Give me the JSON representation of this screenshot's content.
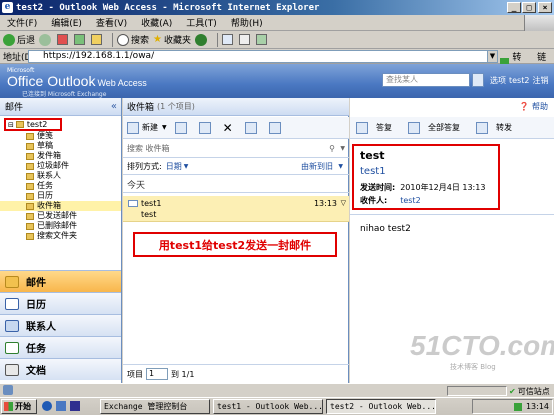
{
  "window": {
    "title": "test2 - Outlook Web Access - Microsoft Internet Explorer"
  },
  "menubar": [
    "文件(F)",
    "编辑(E)",
    "查看(V)",
    "收藏(A)",
    "工具(T)",
    "帮助(H)"
  ],
  "toolbar": {
    "back": "后退",
    "search": "搜索",
    "favorites": "收藏夹"
  },
  "address": {
    "label": "地址(D)",
    "url": "https://192.168.1.1/owa/",
    "go": "转到",
    "links": "链接"
  },
  "owa": {
    "ms_label": "Microsoft",
    "product": "Office Outlook",
    "product_suffix": "Web Access",
    "subtitle": "已连接到 Microsoft Exchange",
    "find_placeholder": "查找某人",
    "options": "选项",
    "user": "test2",
    "logout": "注销"
  },
  "left_nav": {
    "header": "邮件",
    "root": "test2",
    "folders": [
      "便笺",
      "草稿",
      "发件箱",
      "垃圾邮件",
      "联系人",
      "任务",
      "日历",
      "收件箱",
      "已发送邮件",
      "已删除邮件",
      "搜索文件夹"
    ],
    "selected_index": 7,
    "modules": [
      "邮件",
      "日历",
      "联系人",
      "任务",
      "文档"
    ]
  },
  "message_list": {
    "folder": "收件箱",
    "count": "(1 个项目)",
    "new_button": "新建",
    "search_placeholder": "搜索 收件箱",
    "sort_label": "排列方式:",
    "sort_by": "日期",
    "sort_order": "由新到旧",
    "group": "今天",
    "items": [
      {
        "from": "test1",
        "subject": "test",
        "time": "13:13"
      }
    ],
    "pager_label": "项目",
    "pager_value": "1",
    "pager_total": "到 1/1"
  },
  "annotation": "用test1给test2发送一封邮件",
  "reading_pane": {
    "reply": "答复",
    "reply_all": "全部答复",
    "forward": "转发",
    "help": "帮助",
    "subject": "test",
    "from": "test1",
    "sent_label": "发送时间:",
    "sent_value": "2010年12月4日 13:13",
    "to_label": "收件人:",
    "to_value": "test2",
    "body": "nihao test2"
  },
  "statusbar": {
    "zone": "可信站点"
  },
  "taskbar": {
    "start": "开始",
    "tasks": [
      "Exchange 管理控制台",
      "test1 - Outlook Web...",
      "test2 - Outlook Web..."
    ],
    "time": "13:14"
  },
  "watermark": {
    "main": "51CTO.com",
    "sub": "技术博客 Blog"
  }
}
